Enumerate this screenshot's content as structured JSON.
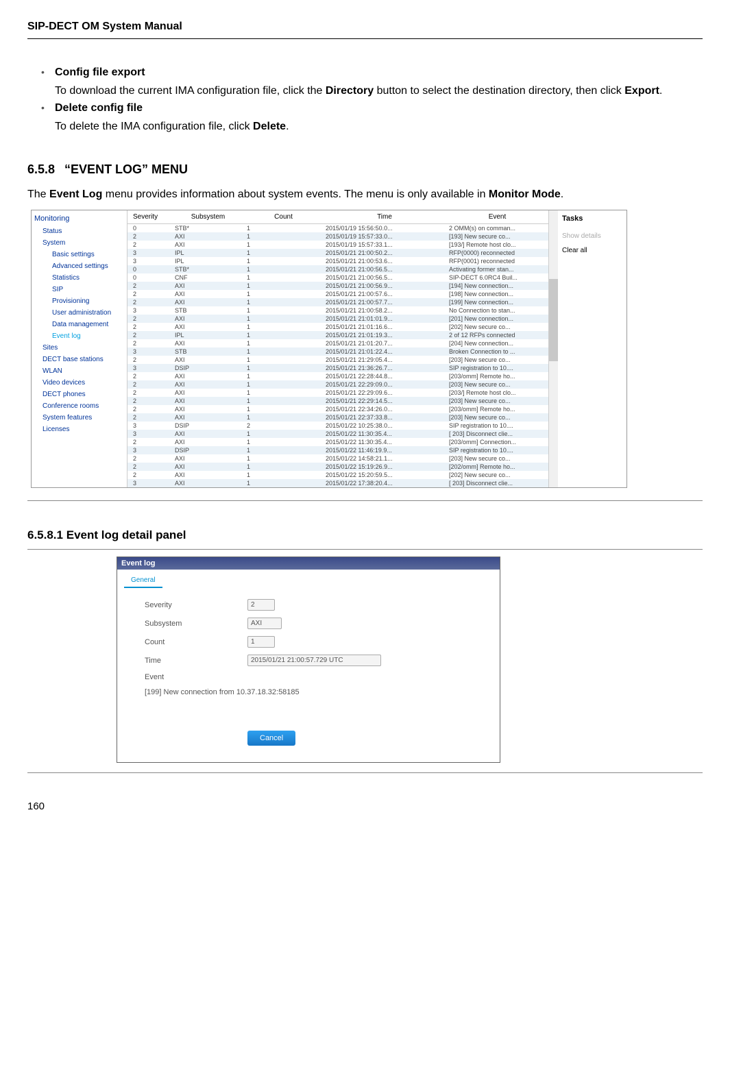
{
  "header": {
    "title": "SIP-DECT OM System Manual"
  },
  "bullets": [
    {
      "title": "Config file export",
      "body_parts": [
        "To download the current IMA configuration file, click the ",
        "Directory",
        " button to select the destination directory, then click ",
        "Export",
        "."
      ]
    },
    {
      "title": "Delete config file",
      "body_parts": [
        "To delete the IMA configuration file, click ",
        "Delete",
        "."
      ]
    }
  ],
  "section": {
    "number": "6.5.8",
    "title": "“EVENT LOG” MENU",
    "intro_parts": [
      "The ",
      "Event Log",
      " menu provides information about system events. The menu is only available in ",
      "Monitor Mode",
      "."
    ]
  },
  "sidebar": {
    "heading": "Monitoring",
    "level1_before": [
      "Status",
      "System"
    ],
    "level2": [
      "Basic settings",
      "Advanced settings",
      "Statistics",
      "SIP",
      "Provisioning",
      "User administration",
      "Data management"
    ],
    "level2_active": "Event log",
    "level1_after": [
      "Sites",
      "DECT base stations",
      "WLAN",
      "Video devices",
      "DECT phones",
      "Conference rooms",
      "System features",
      "Licenses"
    ]
  },
  "table": {
    "headers": {
      "severity": "Severity",
      "subsystem": "Subsystem",
      "count": "Count",
      "time": "Time",
      "event": "Event"
    },
    "rows": [
      {
        "sev": "0",
        "sub": "STB*",
        "cnt": "1",
        "time": "2015/01/19 15:56:50.0...",
        "evt": "2 OMM(s) on comman..."
      },
      {
        "sev": "2",
        "sub": "AXI",
        "cnt": "1",
        "time": "2015/01/19 15:57:33.0...",
        "evt": "[193] New secure co..."
      },
      {
        "sev": "2",
        "sub": "AXI",
        "cnt": "1",
        "time": "2015/01/19 15:57:33.1...",
        "evt": "[193/] Remote host clo..."
      },
      {
        "sev": "3",
        "sub": "IPL",
        "cnt": "1",
        "time": "2015/01/21 21:00:50.2...",
        "evt": "RFP(0000) reconnected"
      },
      {
        "sev": "3",
        "sub": "IPL",
        "cnt": "1",
        "time": "2015/01/21 21:00:53.6...",
        "evt": "RFP(0001) reconnected"
      },
      {
        "sev": "0",
        "sub": "STB*",
        "cnt": "1",
        "time": "2015/01/21 21:00:56.5...",
        "evt": "Activating former stan..."
      },
      {
        "sev": "0",
        "sub": "CNF",
        "cnt": "1",
        "time": "2015/01/21 21:00:56.5...",
        "evt": "SIP-DECT 6.0RC4 Buil..."
      },
      {
        "sev": "2",
        "sub": "AXI",
        "cnt": "1",
        "time": "2015/01/21 21:00:56.9...",
        "evt": "[194] New connection..."
      },
      {
        "sev": "2",
        "sub": "AXI",
        "cnt": "1",
        "time": "2015/01/21 21:00:57.6...",
        "evt": "[198] New connection..."
      },
      {
        "sev": "2",
        "sub": "AXI",
        "cnt": "1",
        "time": "2015/01/21 21:00:57.7...",
        "evt": "[199] New connection..."
      },
      {
        "sev": "3",
        "sub": "STB",
        "cnt": "1",
        "time": "2015/01/21 21:00:58.2...",
        "evt": "No Connection to stan..."
      },
      {
        "sev": "2",
        "sub": "AXI",
        "cnt": "1",
        "time": "2015/01/21 21:01:01.9...",
        "evt": "[201] New connection..."
      },
      {
        "sev": "2",
        "sub": "AXI",
        "cnt": "1",
        "time": "2015/01/21 21:01:16.6...",
        "evt": "[202] New secure co..."
      },
      {
        "sev": "2",
        "sub": "IPL",
        "cnt": "1",
        "time": "2015/01/21 21:01:19.3...",
        "evt": "2 of 12 RFPs connected"
      },
      {
        "sev": "2",
        "sub": "AXI",
        "cnt": "1",
        "time": "2015/01/21 21:01:20.7...",
        "evt": "[204] New connection..."
      },
      {
        "sev": "3",
        "sub": "STB",
        "cnt": "1",
        "time": "2015/01/21 21:01:22.4...",
        "evt": "Broken Connection to ..."
      },
      {
        "sev": "2",
        "sub": "AXI",
        "cnt": "1",
        "time": "2015/01/21 21:29:05.4...",
        "evt": "[203] New secure co..."
      },
      {
        "sev": "3",
        "sub": "DSIP",
        "cnt": "1",
        "time": "2015/01/21 21:36:26.7...",
        "evt": "SIP registration to 10...."
      },
      {
        "sev": "2",
        "sub": "AXI",
        "cnt": "1",
        "time": "2015/01/21 22:28:44.8...",
        "evt": "[203/omm] Remote ho..."
      },
      {
        "sev": "2",
        "sub": "AXI",
        "cnt": "1",
        "time": "2015/01/21 22:29:09.0...",
        "evt": "[203] New secure co..."
      },
      {
        "sev": "2",
        "sub": "AXI",
        "cnt": "1",
        "time": "2015/01/21 22:29:09.6...",
        "evt": "[203/] Remote host clo..."
      },
      {
        "sev": "2",
        "sub": "AXI",
        "cnt": "1",
        "time": "2015/01/21 22:29:14.5...",
        "evt": "[203] New secure co..."
      },
      {
        "sev": "2",
        "sub": "AXI",
        "cnt": "1",
        "time": "2015/01/21 22:34:26.0...",
        "evt": "[203/omm] Remote ho..."
      },
      {
        "sev": "2",
        "sub": "AXI",
        "cnt": "1",
        "time": "2015/01/21 22:37:33.8...",
        "evt": "[203] New secure co..."
      },
      {
        "sev": "3",
        "sub": "DSIP",
        "cnt": "2",
        "time": "2015/01/22 10:25:38.0...",
        "evt": "SIP registration to 10...."
      },
      {
        "sev": "3",
        "sub": "AXI",
        "cnt": "1",
        "time": "2015/01/22 11:30:35.4...",
        "evt": "[  203] Disconnect clie..."
      },
      {
        "sev": "2",
        "sub": "AXI",
        "cnt": "1",
        "time": "2015/01/22 11:30:35.4...",
        "evt": "[203/omm] Connection..."
      },
      {
        "sev": "3",
        "sub": "DSIP",
        "cnt": "1",
        "time": "2015/01/22 11:46:19.9...",
        "evt": "SIP registration to 10...."
      },
      {
        "sev": "2",
        "sub": "AXI",
        "cnt": "1",
        "time": "2015/01/22 14:58:21.1...",
        "evt": "[203] New secure co..."
      },
      {
        "sev": "2",
        "sub": "AXI",
        "cnt": "1",
        "time": "2015/01/22 15:19:26.9...",
        "evt": "[202/omm] Remote ho..."
      },
      {
        "sev": "2",
        "sub": "AXI",
        "cnt": "1",
        "time": "2015/01/22 15:20:59.5...",
        "evt": "[202] New secure co..."
      },
      {
        "sev": "3",
        "sub": "AXI",
        "cnt": "1",
        "time": "2015/01/22 17:38:20.4...",
        "evt": "[  203] Disconnect clie..."
      }
    ]
  },
  "tasks": {
    "heading": "Tasks",
    "show_details": "Show details",
    "clear_all": "Clear all"
  },
  "subsection": {
    "number": "6.5.8.1",
    "title": "Event log detail panel"
  },
  "detail": {
    "header": "Event log",
    "tab": "General",
    "labels": {
      "severity": "Severity",
      "subsystem": "Subsystem",
      "count": "Count",
      "time": "Time",
      "event": "Event"
    },
    "values": {
      "severity": "2",
      "subsystem": "AXI",
      "count": "1",
      "time": "2015/01/21 21:00:57.729 UTC"
    },
    "event_text": "[199] New connection from 10.37.18.32:58185",
    "cancel": "Cancel"
  },
  "page_number": "160"
}
